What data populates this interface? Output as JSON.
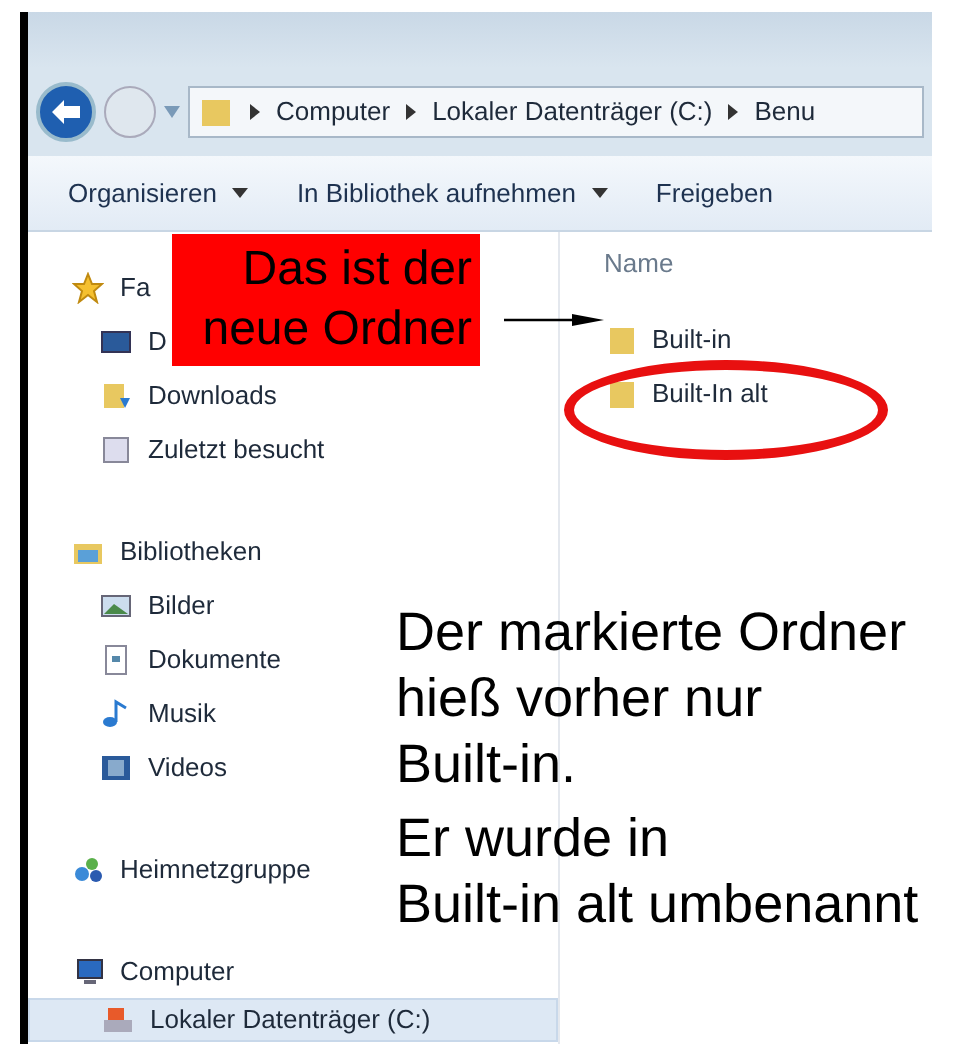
{
  "address_bar": {
    "breadcrumbs": [
      "Computer",
      "Lokaler Datenträger (C:)",
      "Benu"
    ]
  },
  "toolbar": [
    {
      "label": "Organisieren",
      "dropdown": true
    },
    {
      "label": "In Bibliothek aufnehmen",
      "dropdown": true
    },
    {
      "label": "Freigeben",
      "dropdown": false
    }
  ],
  "sidebar": [
    {
      "label": "Fa",
      "kind": "star",
      "selected": false,
      "children": [
        {
          "label": "D",
          "kind": "desktop",
          "selected": false
        },
        {
          "label": "Downloads",
          "kind": "download",
          "selected": false
        },
        {
          "label": "Zuletzt besucht",
          "kind": "recent",
          "selected": false
        }
      ]
    },
    {
      "label": "Bibliotheken",
      "kind": "library",
      "selected": false,
      "children": [
        {
          "label": "Bilder",
          "kind": "picture",
          "selected": false
        },
        {
          "label": "Dokumente",
          "kind": "document",
          "selected": false
        },
        {
          "label": "Musik",
          "kind": "music",
          "selected": false
        },
        {
          "label": "Videos",
          "kind": "video",
          "selected": false
        }
      ]
    },
    {
      "label": "Heimnetzgruppe",
      "kind": "network",
      "selected": false
    },
    {
      "label": "Computer",
      "kind": "computer",
      "selected": false,
      "children": [
        {
          "label": "Lokaler Datenträger (C:)",
          "kind": "drive",
          "selected": true
        }
      ]
    }
  ],
  "file_list": {
    "column": "Name",
    "files": [
      {
        "name": "Built-in",
        "circled": false
      },
      {
        "name": "Built-In alt",
        "circled": true
      }
    ]
  },
  "callout": {
    "lines": [
      "Das ist der",
      "neue Ordner"
    ]
  },
  "note": {
    "lines": [
      "Der markierte Ordner",
      "hieß vorher nur",
      "Built-in.",
      "Er wurde in",
      "Built-in alt umbenannt"
    ]
  }
}
